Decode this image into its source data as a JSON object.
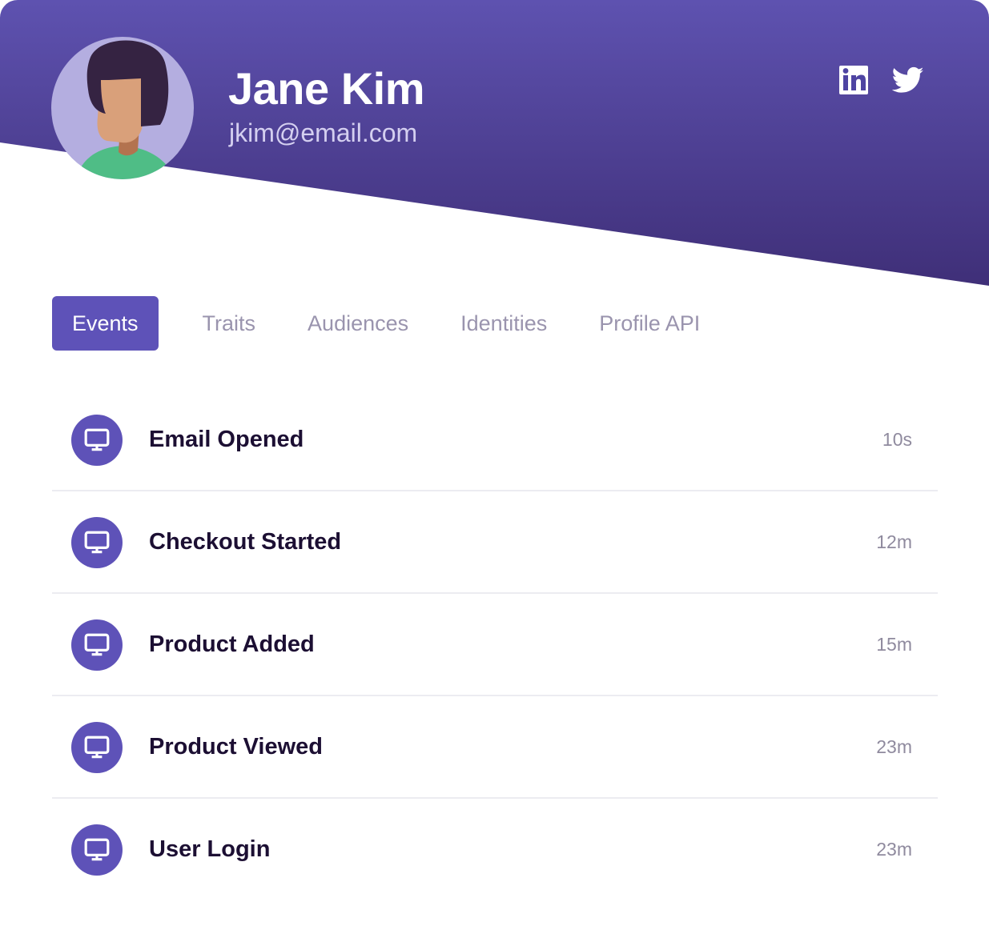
{
  "colors": {
    "header_top": "#5e52b0",
    "header_bottom": "#3f2f78",
    "accent": "#5e52b8",
    "title_text": "#1c0f33",
    "muted_text": "#9a94ae"
  },
  "profile": {
    "name": "Jane Kim",
    "email": "jkim@email.com",
    "avatar_icon": "person-avatar"
  },
  "social": [
    {
      "name": "linkedin",
      "icon": "linkedin-icon"
    },
    {
      "name": "twitter",
      "icon": "twitter-icon"
    }
  ],
  "tabs": [
    {
      "label": "Events",
      "active": true
    },
    {
      "label": "Traits",
      "active": false
    },
    {
      "label": "Audiences",
      "active": false
    },
    {
      "label": "Identities",
      "active": false
    },
    {
      "label": "Profile API",
      "active": false
    }
  ],
  "events": [
    {
      "title": "Email Opened",
      "time": "10s",
      "icon": "monitor-icon"
    },
    {
      "title": "Checkout Started",
      "time": "12m",
      "icon": "monitor-icon"
    },
    {
      "title": "Product Added",
      "time": "15m",
      "icon": "monitor-icon"
    },
    {
      "title": "Product Viewed",
      "time": "23m",
      "icon": "monitor-icon"
    },
    {
      "title": "User Login",
      "time": "23m",
      "icon": "monitor-icon"
    }
  ]
}
